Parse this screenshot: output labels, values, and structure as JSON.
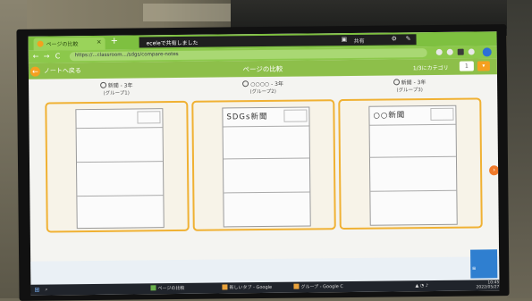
{
  "browser": {
    "tab_title": "ページの比較",
    "new_tab": "+",
    "share_notice": "eceleで共有しました",
    "share_status": "共有",
    "url": "https://...classroom.../sdgs/compare-notes",
    "nav": {
      "back": "←",
      "forward": "→",
      "reload": "C"
    }
  },
  "app": {
    "back_label": "ノートへ戻る",
    "title": "ページの比較",
    "page_indicator": "1/3にカテゴリ",
    "page_number": "1",
    "page_toggle": "▾"
  },
  "columns": [
    {
      "owner": "新聞 - 3年",
      "group": "(グループ1)",
      "sheet_text": ""
    },
    {
      "owner": "○○○○ - 3年",
      "group": "(グループ2)",
      "sheet_text": "SDGs新聞"
    },
    {
      "owner": "新聞 - 3年",
      "group": "(グループ3)",
      "sheet_text": "○○新聞"
    }
  ],
  "taskbar": {
    "items": [
      "ページの比較",
      "新しいタブ - Google",
      "グループ - Google C"
    ],
    "clock_time": "10:45",
    "clock_date": "2022/05/27"
  },
  "colors": {
    "accent_green": "#8dbf4a",
    "accent_orange": "#f0b133"
  }
}
